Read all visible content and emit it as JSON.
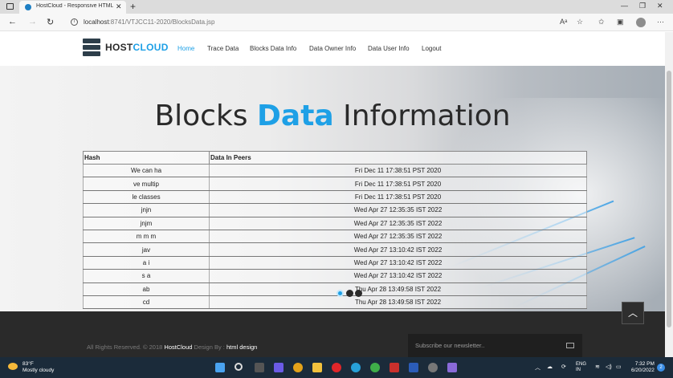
{
  "browser": {
    "tab_title": "HostCloud - Responsive HTML5",
    "url_host": "localhost",
    "url_rest": ":8741/VTJCC11-2020/BlocksData.jsp"
  },
  "site": {
    "logo_part1": "HOST",
    "logo_part2": "CLOUD",
    "nav": [
      "Home",
      "Trace Data",
      "Blocks Data Info",
      "Data Owner Info",
      "Data User Info",
      "Logout"
    ],
    "active_nav": "Home"
  },
  "hero": {
    "title_pre": "Blocks ",
    "title_highlight": "Data",
    "title_post": " Information"
  },
  "table": {
    "headers": [
      "Hash",
      "Data In Peers"
    ],
    "rows": [
      [
        "We can ha",
        "Fri Dec 11 17:38:51 PST 2020"
      ],
      [
        "ve multip",
        "Fri Dec 11 17:38:51 PST 2020"
      ],
      [
        "le classes",
        "Fri Dec 11 17:38:51 PST 2020"
      ],
      [
        "jnjn",
        "Wed Apr 27 12:35:35 IST 2022"
      ],
      [
        "jnjm",
        "Wed Apr 27 12:35:35 IST 2022"
      ],
      [
        "m m m",
        "Wed Apr 27 12:35:35 IST 2022"
      ],
      [
        "jav",
        "Wed Apr 27 13:10:42 IST 2022"
      ],
      [
        "a i",
        "Wed Apr 27 13:10:42 IST 2022"
      ],
      [
        "s a",
        "Wed Apr 27 13:10:42 IST 2022"
      ],
      [
        "ab",
        "Thu Apr 28 13:49:58 IST 2022"
      ],
      [
        "cd",
        "Thu Apr 28 13:49:58 IST 2022"
      ]
    ]
  },
  "footer": {
    "copy_pre": "All Rights Reserved. © 2018 ",
    "copy_brand": "HostCloud",
    "copy_mid": " Design By : ",
    "copy_designer": "html design",
    "subscribe_placeholder": "Subscribe our newsletter.."
  },
  "taskbar": {
    "temp": "83°F",
    "weather": "Mostly cloudy",
    "lang1": "ENG",
    "lang2": "IN",
    "time": "7:32 PM",
    "date": "6/20/2022",
    "notifications": "2"
  },
  "colors": {
    "accent": "#1ea0e6",
    "footer": "#2a2a2a",
    "taskbar": "#1b2b3a"
  }
}
